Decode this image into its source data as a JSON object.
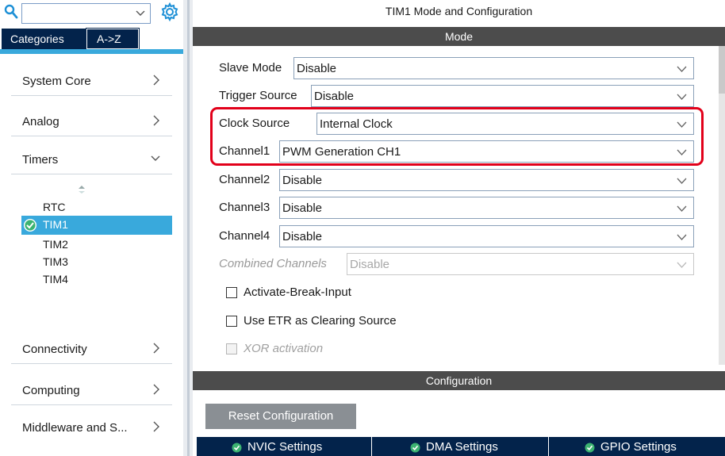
{
  "sidebar": {
    "search": {
      "value": ""
    },
    "tabs": {
      "categories": "Categories",
      "az": "A->Z"
    },
    "categories": [
      {
        "label": "System Core"
      },
      {
        "label": "Analog"
      },
      {
        "label": "Timers"
      },
      {
        "label": "Connectivity"
      },
      {
        "label": "Computing"
      },
      {
        "label": "Middleware and S..."
      }
    ],
    "timers": [
      "RTC",
      "TIM1",
      "TIM2",
      "TIM3",
      "TIM4"
    ],
    "selected_timer": "TIM1"
  },
  "panel": {
    "title": "TIM1 Mode and Configuration",
    "mode_header": "Mode",
    "fields": [
      {
        "label": "Slave Mode",
        "value": "Disable"
      },
      {
        "label": "Trigger Source",
        "value": "Disable"
      },
      {
        "label": "Clock Source",
        "value": "Internal Clock"
      },
      {
        "label": "Channel1",
        "value": "PWM Generation CH1"
      },
      {
        "label": "Channel2",
        "value": "Disable"
      },
      {
        "label": "Channel3",
        "value": "Disable"
      },
      {
        "label": "Channel4",
        "value": "Disable"
      },
      {
        "label": "Combined Channels",
        "value": "Disable",
        "disabled": true
      }
    ],
    "checkboxes": [
      {
        "label": "Activate-Break-Input",
        "checked": false
      },
      {
        "label": "Use ETR as Clearing Source",
        "checked": false
      },
      {
        "label": "XOR activation",
        "checked": false,
        "disabled": true
      }
    ],
    "config_header": "Configuration",
    "reset_button": "Reset Configuration",
    "settings_tabs": [
      "NVIC Settings",
      "DMA Settings",
      "GPIO Settings"
    ]
  },
  "colors": {
    "navy": "#03234b",
    "accent_blue": "#39a9dc",
    "section_bar": "#4c4c4c",
    "highlight_red": "#e2001a",
    "check_green": "#3cb371"
  }
}
